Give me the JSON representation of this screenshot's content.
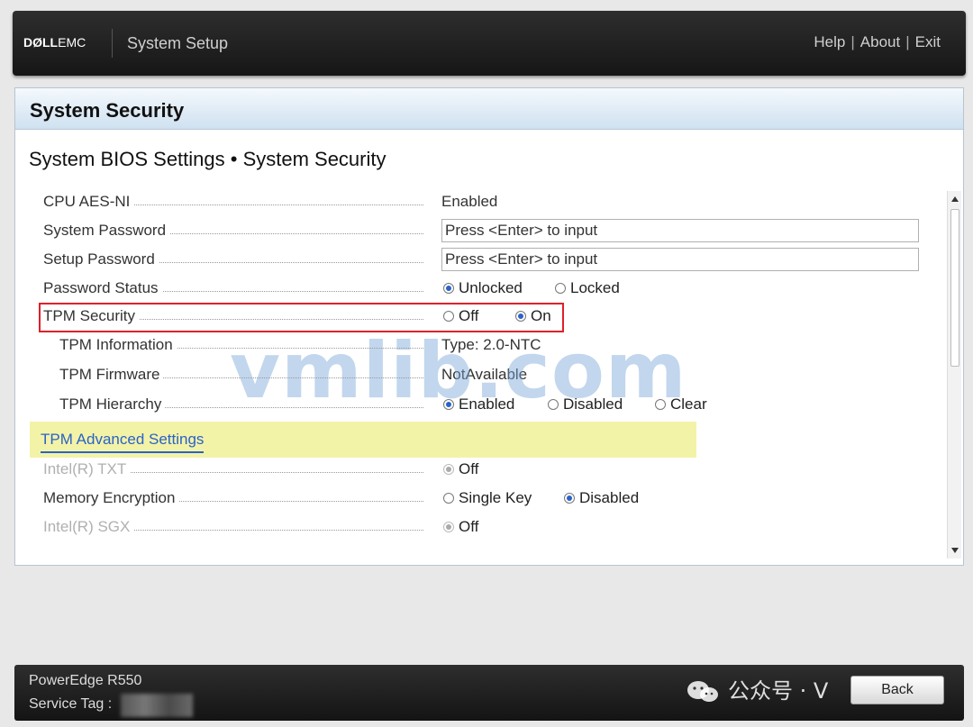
{
  "header": {
    "brand_bold": "DØLL",
    "brand_light": "EMC",
    "app_title": "System Setup",
    "links": [
      "Help",
      "About",
      "Exit"
    ],
    "separator": "|"
  },
  "panel": {
    "title": "System Security",
    "breadcrumb": "System BIOS Settings • System Security"
  },
  "settings": {
    "cpu_aes": {
      "label": "CPU AES-NI",
      "value": "Enabled"
    },
    "system_password": {
      "label": "System Password",
      "value": "Press <Enter> to input"
    },
    "setup_password": {
      "label": "Setup Password",
      "value": "Press <Enter> to input"
    },
    "password_status": {
      "label": "Password Status",
      "options": [
        "Unlocked",
        "Locked"
      ],
      "selected": "Unlocked"
    },
    "tpm_security": {
      "label": "TPM Security",
      "options": [
        "Off",
        "On"
      ],
      "selected": "On"
    },
    "tpm_information": {
      "label": "TPM Information",
      "value": "Type: 2.0-NTC"
    },
    "tpm_firmware": {
      "label": "TPM Firmware",
      "value": "NotAvailable"
    },
    "tpm_hierarchy": {
      "label": "TPM Hierarchy",
      "options": [
        "Enabled",
        "Disabled",
        "Clear"
      ],
      "selected": "Enabled"
    },
    "tpm_advanced": {
      "label": "TPM Advanced Settings"
    },
    "intel_txt": {
      "label": "Intel(R) TXT",
      "options": [
        "Off"
      ],
      "selected": "Off"
    },
    "memory_encryption": {
      "label": "Memory Encryption",
      "options": [
        "Single Key",
        "Disabled"
      ],
      "selected": "Disabled"
    },
    "intel_sgx": {
      "label": "Intel(R) SGX",
      "options": [
        "Off"
      ],
      "selected": "Off"
    }
  },
  "watermark": "vmlib.com",
  "footer": {
    "model": "PowerEdge R550",
    "service_tag_label": "Service Tag :",
    "back_label": "Back"
  },
  "overlay": {
    "wechat_text": "公众号 · V"
  },
  "colors": {
    "accent": "#2a62c9",
    "highlight": "#e0202a",
    "advanced_bg": "#f3f3a8"
  }
}
